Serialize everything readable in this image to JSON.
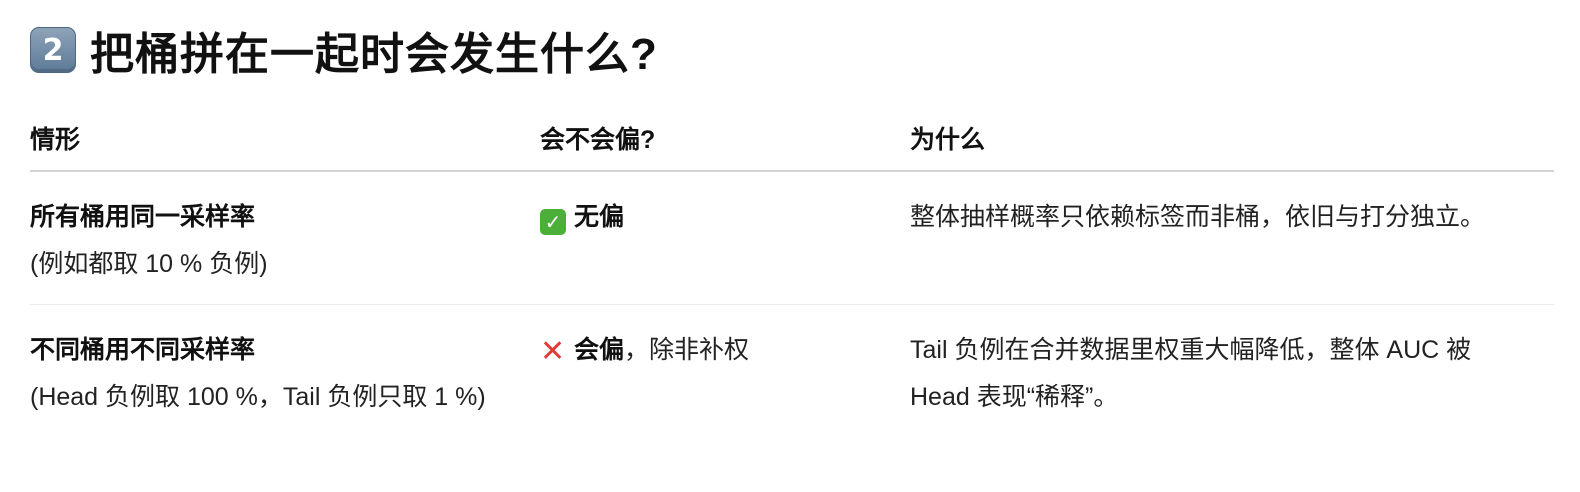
{
  "heading": {
    "number": "2",
    "title": "把桶拼在一起时会发生什么?"
  },
  "table": {
    "headers": [
      "情形",
      "会不会偏?",
      "为什么"
    ],
    "rows": [
      {
        "case_title": "所有桶用同一采样率",
        "case_note": "(例如都取 10 % 负例)",
        "verdict_icon": "check-mark-icon",
        "verdict_bold": "无偏",
        "verdict_rest": "",
        "reason": "整体抽样概率只依赖标签而非桶，依旧与打分独立。"
      },
      {
        "case_title": "不同桶用不同采样率",
        "case_note": "(Head 负例取 100 %，Tail 负例只取 1 %)",
        "verdict_icon": "cross-mark-icon",
        "verdict_bold": "会偏",
        "verdict_rest": "，除非补权",
        "reason": "Tail 负例在合并数据里权重大幅降低，整体 AUC 被 Head 表现“稀释”。"
      }
    ]
  },
  "colors": {
    "check": "#4caf3a",
    "cross": "#e53935",
    "keycap": "#6b86a3"
  }
}
